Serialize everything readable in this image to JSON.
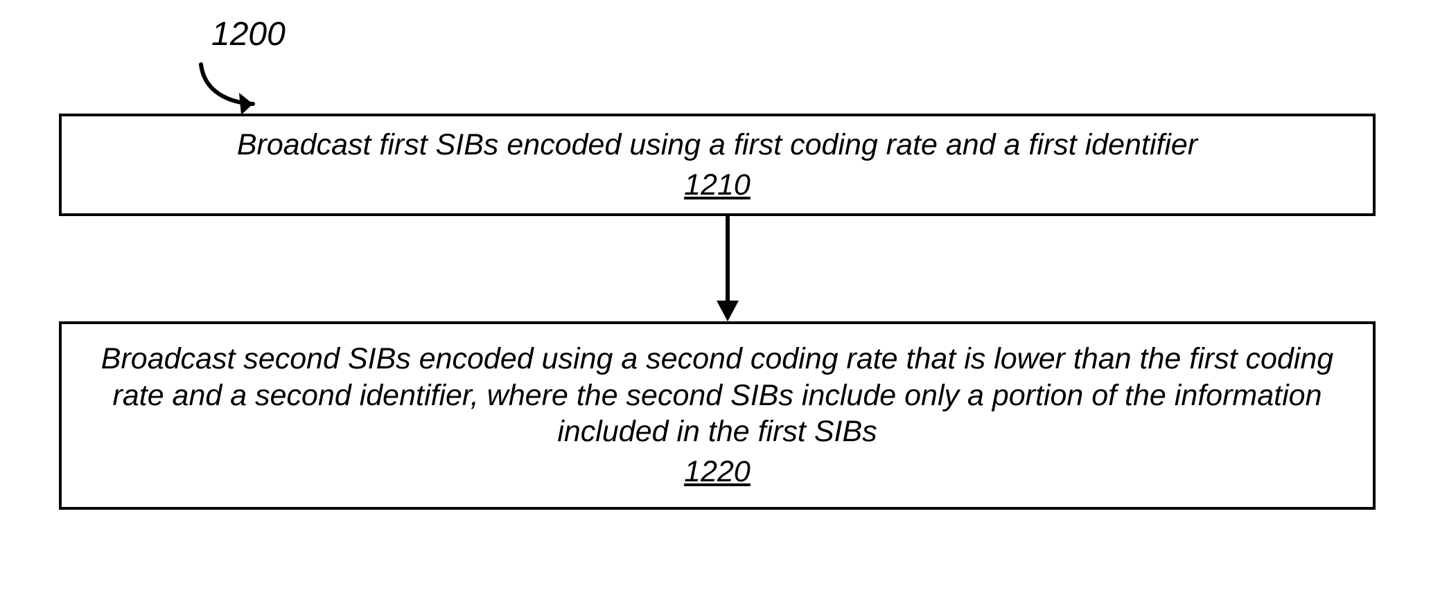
{
  "diagram": {
    "reference_number": "1200",
    "step1": {
      "text": "Broadcast first SIBs encoded using a first coding rate and a first identifier",
      "number": "1210"
    },
    "step2": {
      "text": "Broadcast second SIBs encoded using a second coding rate that is lower than the first coding rate and a second identifier, where the second SIBs include only a portion of the information included in the first SIBs",
      "number": "1220"
    }
  }
}
